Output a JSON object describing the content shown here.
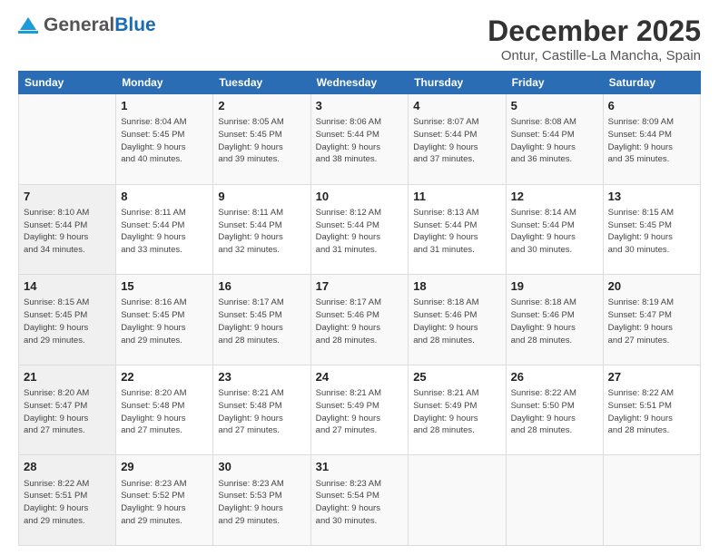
{
  "header": {
    "logo_general": "General",
    "logo_blue": "Blue",
    "title": "December 2025",
    "subtitle": "Ontur, Castille-La Mancha, Spain"
  },
  "calendar": {
    "days_of_week": [
      "Sunday",
      "Monday",
      "Tuesday",
      "Wednesday",
      "Thursday",
      "Friday",
      "Saturday"
    ],
    "weeks": [
      [
        {
          "day": "",
          "info": ""
        },
        {
          "day": "1",
          "info": "Sunrise: 8:04 AM\nSunset: 5:45 PM\nDaylight: 9 hours\nand 40 minutes."
        },
        {
          "day": "2",
          "info": "Sunrise: 8:05 AM\nSunset: 5:45 PM\nDaylight: 9 hours\nand 39 minutes."
        },
        {
          "day": "3",
          "info": "Sunrise: 8:06 AM\nSunset: 5:44 PM\nDaylight: 9 hours\nand 38 minutes."
        },
        {
          "day": "4",
          "info": "Sunrise: 8:07 AM\nSunset: 5:44 PM\nDaylight: 9 hours\nand 37 minutes."
        },
        {
          "day": "5",
          "info": "Sunrise: 8:08 AM\nSunset: 5:44 PM\nDaylight: 9 hours\nand 36 minutes."
        },
        {
          "day": "6",
          "info": "Sunrise: 8:09 AM\nSunset: 5:44 PM\nDaylight: 9 hours\nand 35 minutes."
        }
      ],
      [
        {
          "day": "7",
          "info": "Sunrise: 8:10 AM\nSunset: 5:44 PM\nDaylight: 9 hours\nand 34 minutes."
        },
        {
          "day": "8",
          "info": "Sunrise: 8:11 AM\nSunset: 5:44 PM\nDaylight: 9 hours\nand 33 minutes."
        },
        {
          "day": "9",
          "info": "Sunrise: 8:11 AM\nSunset: 5:44 PM\nDaylight: 9 hours\nand 32 minutes."
        },
        {
          "day": "10",
          "info": "Sunrise: 8:12 AM\nSunset: 5:44 PM\nDaylight: 9 hours\nand 31 minutes."
        },
        {
          "day": "11",
          "info": "Sunrise: 8:13 AM\nSunset: 5:44 PM\nDaylight: 9 hours\nand 31 minutes."
        },
        {
          "day": "12",
          "info": "Sunrise: 8:14 AM\nSunset: 5:44 PM\nDaylight: 9 hours\nand 30 minutes."
        },
        {
          "day": "13",
          "info": "Sunrise: 8:15 AM\nSunset: 5:45 PM\nDaylight: 9 hours\nand 30 minutes."
        }
      ],
      [
        {
          "day": "14",
          "info": "Sunrise: 8:15 AM\nSunset: 5:45 PM\nDaylight: 9 hours\nand 29 minutes."
        },
        {
          "day": "15",
          "info": "Sunrise: 8:16 AM\nSunset: 5:45 PM\nDaylight: 9 hours\nand 29 minutes."
        },
        {
          "day": "16",
          "info": "Sunrise: 8:17 AM\nSunset: 5:45 PM\nDaylight: 9 hours\nand 28 minutes."
        },
        {
          "day": "17",
          "info": "Sunrise: 8:17 AM\nSunset: 5:46 PM\nDaylight: 9 hours\nand 28 minutes."
        },
        {
          "day": "18",
          "info": "Sunrise: 8:18 AM\nSunset: 5:46 PM\nDaylight: 9 hours\nand 28 minutes."
        },
        {
          "day": "19",
          "info": "Sunrise: 8:18 AM\nSunset: 5:46 PM\nDaylight: 9 hours\nand 28 minutes."
        },
        {
          "day": "20",
          "info": "Sunrise: 8:19 AM\nSunset: 5:47 PM\nDaylight: 9 hours\nand 27 minutes."
        }
      ],
      [
        {
          "day": "21",
          "info": "Sunrise: 8:20 AM\nSunset: 5:47 PM\nDaylight: 9 hours\nand 27 minutes."
        },
        {
          "day": "22",
          "info": "Sunrise: 8:20 AM\nSunset: 5:48 PM\nDaylight: 9 hours\nand 27 minutes."
        },
        {
          "day": "23",
          "info": "Sunrise: 8:21 AM\nSunset: 5:48 PM\nDaylight: 9 hours\nand 27 minutes."
        },
        {
          "day": "24",
          "info": "Sunrise: 8:21 AM\nSunset: 5:49 PM\nDaylight: 9 hours\nand 27 minutes."
        },
        {
          "day": "25",
          "info": "Sunrise: 8:21 AM\nSunset: 5:49 PM\nDaylight: 9 hours\nand 28 minutes."
        },
        {
          "day": "26",
          "info": "Sunrise: 8:22 AM\nSunset: 5:50 PM\nDaylight: 9 hours\nand 28 minutes."
        },
        {
          "day": "27",
          "info": "Sunrise: 8:22 AM\nSunset: 5:51 PM\nDaylight: 9 hours\nand 28 minutes."
        }
      ],
      [
        {
          "day": "28",
          "info": "Sunrise: 8:22 AM\nSunset: 5:51 PM\nDaylight: 9 hours\nand 29 minutes."
        },
        {
          "day": "29",
          "info": "Sunrise: 8:23 AM\nSunset: 5:52 PM\nDaylight: 9 hours\nand 29 minutes."
        },
        {
          "day": "30",
          "info": "Sunrise: 8:23 AM\nSunset: 5:53 PM\nDaylight: 9 hours\nand 29 minutes."
        },
        {
          "day": "31",
          "info": "Sunrise: 8:23 AM\nSunset: 5:54 PM\nDaylight: 9 hours\nand 30 minutes."
        },
        {
          "day": "",
          "info": ""
        },
        {
          "day": "",
          "info": ""
        },
        {
          "day": "",
          "info": ""
        }
      ]
    ]
  }
}
